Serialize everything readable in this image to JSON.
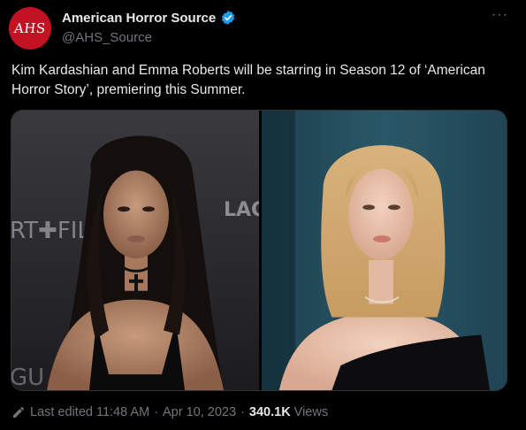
{
  "account": {
    "avatar_text": "AHS",
    "display_name": "American Horror Source",
    "handle": "@AHS_Source",
    "verified_color": "#1d9bf0"
  },
  "menu": {
    "more_label": "···"
  },
  "tweet": {
    "text": "Kim Kardashian and Emma Roberts will be starring in Season 12 of ‘American Horror Story’, premiering this Summer."
  },
  "media": {
    "left_photo_sign_text": [
      "RT FIL",
      "LAC",
      "GU"
    ]
  },
  "footer": {
    "edited_label": "Last edited 11:48 AM",
    "separator": "·",
    "date": "Apr 10, 2023",
    "views_count": "340.1K",
    "views_label": "Views"
  },
  "colors": {
    "background": "#000000",
    "text_primary": "#e7e9ea",
    "text_secondary": "#71767b",
    "avatar_bg": "#c21224"
  }
}
